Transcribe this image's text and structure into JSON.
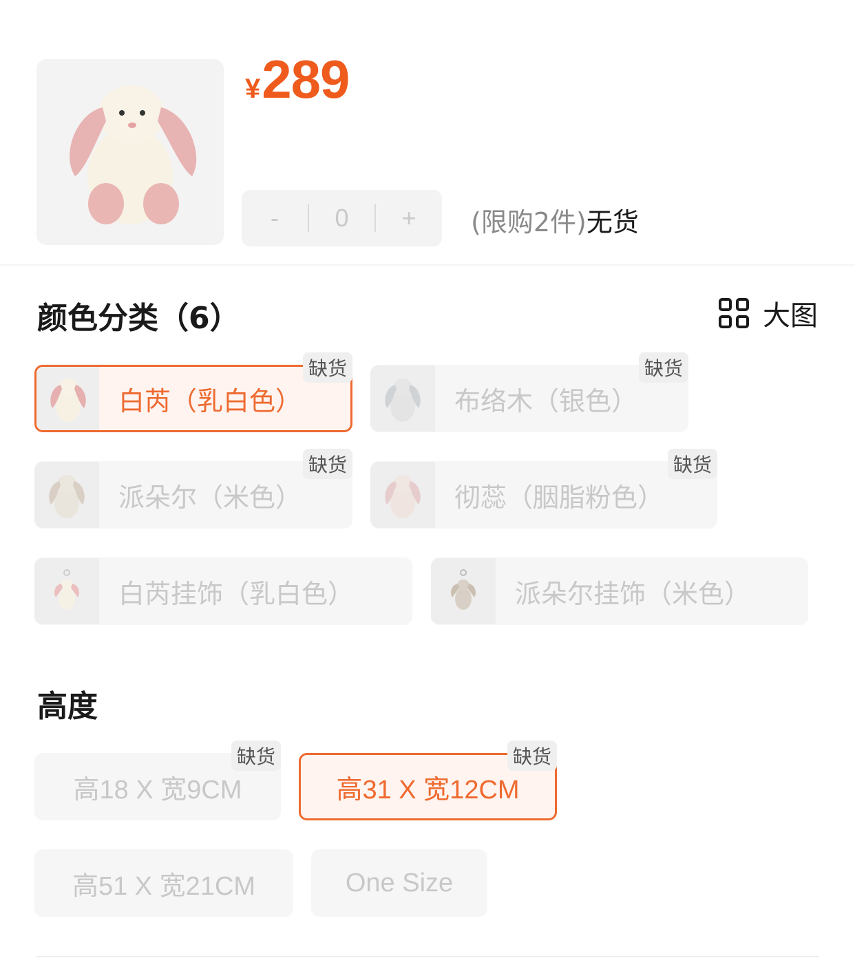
{
  "product": {
    "price_symbol": "¥",
    "price": "289",
    "stepper": {
      "minus": "-",
      "value": "0",
      "plus": "+"
    },
    "limit_text": "(限购2件)",
    "stock_text": "无货"
  },
  "color_section": {
    "title": "颜色分类（6）",
    "big_view_label": "大图",
    "options": [
      {
        "label": "白芮（乳白色）",
        "badge": "缺货",
        "selected": true
      },
      {
        "label": "布络木（银色）",
        "badge": "缺货",
        "selected": false
      },
      {
        "label": "派朵尔（米色）",
        "badge": "缺货",
        "selected": false
      },
      {
        "label": "彻蕊（胭脂粉色）",
        "badge": "缺货",
        "selected": false
      },
      {
        "label": "白芮挂饰（乳白色）",
        "badge": "",
        "selected": false
      },
      {
        "label": "派朵尔挂饰（米色）",
        "badge": "",
        "selected": false
      }
    ]
  },
  "size_section": {
    "title": "高度",
    "options": [
      {
        "label": "高18 X 宽9CM",
        "badge": "缺货",
        "selected": false
      },
      {
        "label": "高31 X 宽12CM",
        "badge": "缺货",
        "selected": true
      },
      {
        "label": "高51 X 宽21CM",
        "badge": "",
        "selected": false
      },
      {
        "label": "One Size",
        "badge": "",
        "selected": false
      }
    ]
  },
  "colors": {
    "accent": "#ee5b1c",
    "chip_bg": "#f6f6f6",
    "selected_bg": "#fff4f0"
  }
}
